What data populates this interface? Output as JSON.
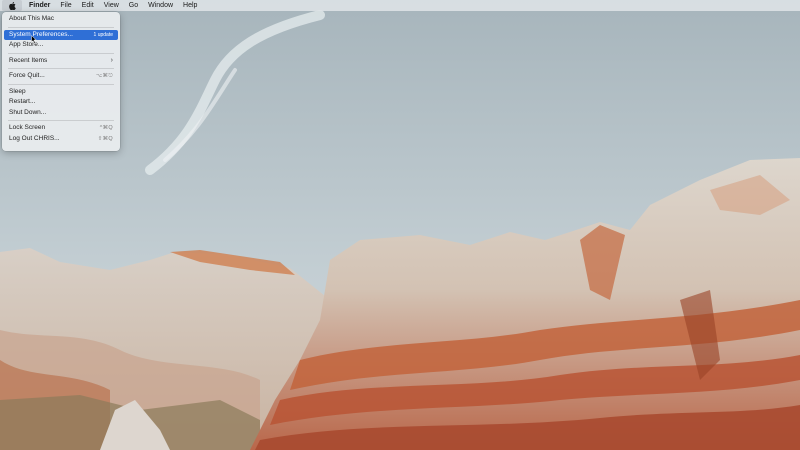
{
  "menubar": {
    "apple_icon": "apple-icon",
    "items": [
      "Finder",
      "File",
      "Edit",
      "View",
      "Go",
      "Window",
      "Help"
    ]
  },
  "apple_dropdown": {
    "about": "About This Mac",
    "system_prefs": "System Preferences...",
    "system_prefs_badge": "1 update",
    "app_store": "App Store...",
    "recent_items": "Recent Items",
    "recent_items_chevron": "›",
    "force_quit": "Force Quit...",
    "force_quit_shortcut": "⌥⌘⎋",
    "sleep": "Sleep",
    "restart": "Restart...",
    "shut_down": "Shut Down...",
    "lock_screen": "Lock Screen",
    "lock_screen_shortcut": "^⌘Q",
    "log_out": "Log Out CHRIS...",
    "log_out_shortcut": "⇧⌘Q"
  },
  "colors": {
    "highlight": "#2f6fd6",
    "sky_top": "#a9b6bd",
    "sky_bottom": "#c6d1d6",
    "rock_white": "#d9d2ca",
    "rock_orange": "#c2643c"
  }
}
